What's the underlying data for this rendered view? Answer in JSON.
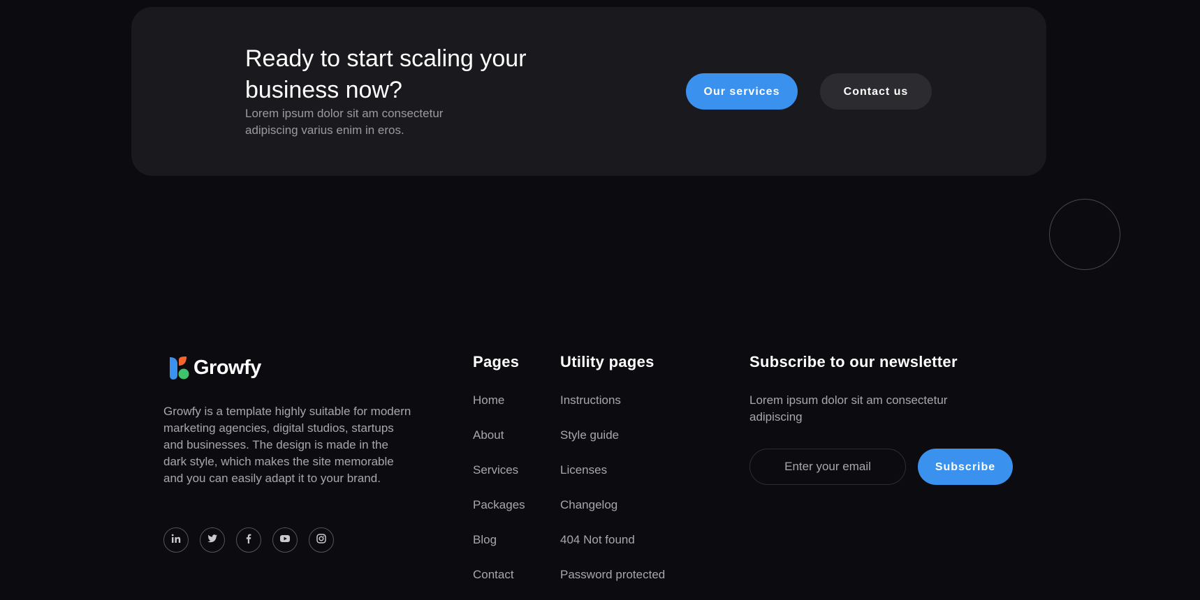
{
  "cta": {
    "title": "Ready to start scaling your business now?",
    "text": "Lorem ipsum dolor sit am consectetur adipiscing varius enim in eros.",
    "primary_button": "Our services",
    "secondary_button": "Contact us"
  },
  "footer": {
    "brand_name": "Growfy",
    "about": "Growfy is a template highly suitable for modern marketing agencies, digital studios, startups and businesses. The design is made in the dark style, which makes the site memorable and you can easily adapt it to your brand.",
    "socials": [
      {
        "icon": "linkedin-icon"
      },
      {
        "icon": "twitter-icon"
      },
      {
        "icon": "facebook-icon"
      },
      {
        "icon": "youtube-icon"
      },
      {
        "icon": "instagram-icon"
      }
    ],
    "pages": {
      "title": "Pages",
      "items": [
        "Home",
        "About",
        "Services",
        "Packages",
        "Blog",
        "Contact"
      ]
    },
    "utility": {
      "title": "Utility pages",
      "items": [
        "Instructions",
        "Style guide",
        "Licenses",
        "Changelog",
        "404 Not found",
        "Password protected"
      ]
    },
    "newsletter": {
      "title": "Subscribe to our newsletter",
      "text": "Lorem ipsum dolor sit am consectetur adipiscing",
      "email_placeholder": "Enter your email",
      "button": "Subscribe"
    }
  },
  "colors": {
    "background": "#0c0b10",
    "card": "#1a191e",
    "accent": "#3a92ee",
    "logo_blue": "#3a92ee",
    "logo_orange": "#f4652e",
    "logo_green": "#3fc26a"
  }
}
